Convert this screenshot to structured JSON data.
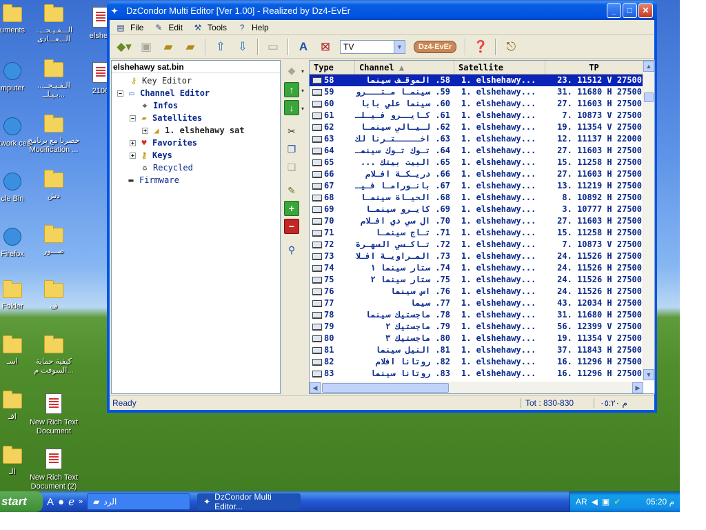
{
  "desktop": {
    "icons": [
      {
        "label": "uments",
        "type": "folder"
      },
      {
        "label": "الـــفـيـجــ... الـــعـــادى",
        "type": "folder"
      },
      {
        "label": "elsheh",
        "type": "doc"
      },
      {
        "label": "mputer",
        "type": "sys"
      },
      {
        "label": "الـفـيـجــ... بـيـلــ...",
        "type": "folder"
      },
      {
        "label": "2106",
        "type": "doc"
      },
      {
        "label": "etwork ces",
        "type": "sys"
      },
      {
        "label": "حصريا مع برنامج Modification ...",
        "type": "folder"
      },
      {
        "label": "cle Bin",
        "type": "sys"
      },
      {
        "label": "دش",
        "type": "folder"
      },
      {
        "label": "Firefox",
        "type": "sys"
      },
      {
        "label": "صـــور",
        "type": "folder"
      },
      {
        "label": "Folder",
        "type": "folder"
      },
      {
        "label": "ف",
        "type": "folder"
      },
      {
        "label": "اسـ",
        "type": "folder"
      },
      {
        "label": "كيفية حماية السوفت م...",
        "type": "folder"
      },
      {
        "label": "افـ",
        "type": "folder"
      },
      {
        "label": "New Rich Text Document",
        "type": "doc"
      },
      {
        "label": "الـ",
        "type": "folder"
      },
      {
        "label": "New Rich Text Document (2)",
        "type": "doc"
      }
    ]
  },
  "window": {
    "title": "DzCondor Multi Editor [Ver 1.00]  - Realized by Dz4-EvEr",
    "menu": [
      "File",
      "Edit",
      "Tools",
      "Help"
    ],
    "toolbar": {
      "tv_select": "TV",
      "brand": "Dz4-EvEr"
    },
    "tree": {
      "header": "elshehawy sat.bin",
      "nodes": [
        "Key Editor",
        "Channel Editor",
        "Infos",
        "Satellites",
        "1. elshehawy sat",
        "Favorites",
        "Keys",
        "Recycled",
        "Firmware"
      ]
    },
    "list": {
      "columns": [
        "Type",
        "Channel",
        "Satellite",
        "TP"
      ],
      "rows": [
        {
          "type": "58",
          "channel": "58. الموقـف سينما",
          "sat": "1. elshehawy...",
          "tp": "23. 11512 V 27500",
          "selected": true
        },
        {
          "type": "59",
          "channel": "59. سينمـا مـتـــرو",
          "sat": "1. elshehawy...",
          "tp": "31. 11680 H 27500"
        },
        {
          "type": "60",
          "channel": "60. سينما علي بابا",
          "sat": "1. elshehawy...",
          "tp": "27. 11603 H 27500"
        },
        {
          "type": "61",
          "channel": "61. كـايــرو فـيـلــم",
          "sat": "1. elshehawy...",
          "tp": "7. 10873 V 27500"
        },
        {
          "type": "62",
          "channel": "62. لـيـالي سينمـا",
          "sat": "1. elshehawy...",
          "tp": "19. 11354 V 27500"
        },
        {
          "type": "63",
          "channel": "63. اخـــــتـرنا لك",
          "sat": "1. elshehawy...",
          "tp": "12. 11137 H 22000"
        },
        {
          "type": "64",
          "channel": "64. تـوك تـوك سينمـا",
          "sat": "1. elshehawy...",
          "tp": "27. 11603 H 27500"
        },
        {
          "type": "65",
          "channel": "65. البيت بيتك ...",
          "sat": "1. elshehawy...",
          "tp": "15. 11258 H 27500"
        },
        {
          "type": "66",
          "channel": "66. دريـكـة افـلام",
          "sat": "1. elshehawy...",
          "tp": "27. 11603 H 27500"
        },
        {
          "type": "67",
          "channel": "67. بانـورامـا فـيـلـم",
          "sat": "1. elshehawy...",
          "tp": "13. 11219 H 27500"
        },
        {
          "type": "68",
          "channel": "68. الحيـاة سينمـا",
          "sat": "1. elshehawy...",
          "tp": "8. 10892 H 27500"
        },
        {
          "type": "69",
          "channel": "69. كايـرو سينمـا",
          "sat": "1. elshehawy...",
          "tp": "3. 10777 H 27500"
        },
        {
          "type": "70",
          "channel": "70. ال سي دي افـلام",
          "sat": "1. elshehawy...",
          "tp": "27. 11603 H 27500"
        },
        {
          "type": "71",
          "channel": "71. تـاج سينمـا",
          "sat": "1. elshehawy...",
          "tp": "15. 11258 H 27500"
        },
        {
          "type": "72",
          "channel": "72. تـاكـسي السهـرة",
          "sat": "1. elshehawy...",
          "tp": "7. 10873 V 27500"
        },
        {
          "type": "73",
          "channel": "73. المـراويـة افـلام",
          "sat": "1. elshehawy...",
          "tp": "24. 11526 H 27500"
        },
        {
          "type": "74",
          "channel": "74. ستار سينما ١",
          "sat": "1. elshehawy...",
          "tp": "24. 11526 H 27500"
        },
        {
          "type": "75",
          "channel": "75. ستار سينما ٢",
          "sat": "1. elshehawy...",
          "tp": "24. 11526 H 27500"
        },
        {
          "type": "76",
          "channel": "76. اس سينما",
          "sat": "1. elshehawy...",
          "tp": "24. 11526 H 27500"
        },
        {
          "type": "77",
          "channel": "77. سيما",
          "sat": "1. elshehawy...",
          "tp": "43. 12034 H 27500"
        },
        {
          "type": "78",
          "channel": "78. ماجستيك سينما",
          "sat": "1. elshehawy...",
          "tp": "31. 11680 H 27500"
        },
        {
          "type": "79",
          "channel": "79. ماجستيك ٢",
          "sat": "1. elshehawy...",
          "tp": "56. 12399 V 27500"
        },
        {
          "type": "80",
          "channel": "80. ماجستيك ٣",
          "sat": "1. elshehawy...",
          "tp": "19. 11354 V 27500"
        },
        {
          "type": "81",
          "channel": "81. النيل سينما",
          "sat": "1. elshehawy...",
          "tp": "37. 11843 H 27500"
        },
        {
          "type": "82",
          "channel": "82. روتانا افلام",
          "sat": "1. elshehawy...",
          "tp": "16. 11296 H 27500"
        },
        {
          "type": "83",
          "channel": "83. روتانا سينما",
          "sat": "1. elshehawy...",
          "tp": "16. 11296 H 27500"
        }
      ]
    },
    "status": {
      "left": "Ready",
      "count": "Tot : 830-830",
      "time": "م ٠٥:٢٠"
    }
  },
  "taskbar": {
    "start": "start",
    "folder_button": "الرد",
    "app_button": "DzCondor Multi Editor...",
    "lang": "AR",
    "clock": "05:20 م"
  },
  "colors": {
    "selection": "#0a24b8",
    "list_text": "#0b2a8c",
    "title_blue": "#0054e3"
  }
}
